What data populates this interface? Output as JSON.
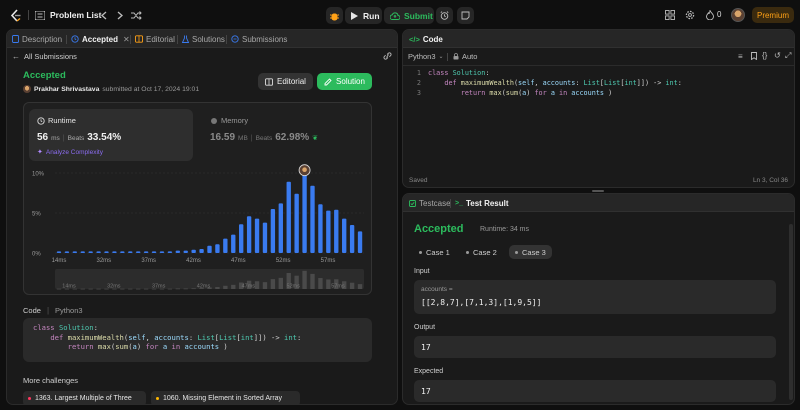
{
  "topbar": {
    "problem_list": "Problem List",
    "run": "Run",
    "submit": "Submit",
    "fire_count": "0",
    "premium": "Premium"
  },
  "left": {
    "tabs": [
      "Description",
      "Accepted",
      "Editorial",
      "Solutions",
      "Submissions"
    ],
    "back_label": "All Submissions",
    "status": "Accepted",
    "user": "Prakhar Shrivastava",
    "submitted": "submitted at Oct 17, 2024 19:01",
    "editorial_btn": "Editorial",
    "solution_btn": "Solution",
    "runtime": {
      "label": "Runtime",
      "value": "56",
      "unit": "ms",
      "beats_label": "Beats",
      "beats": "33.54%",
      "analyze": "Analyze Complexity"
    },
    "memory": {
      "label": "Memory",
      "value": "16.59",
      "unit": "MB",
      "beats_label": "Beats",
      "beats": "62.98%"
    },
    "code_label": "Code",
    "code_lang": "Python3",
    "code_lines": [
      "class Solution:",
      "    def maximumWealth(self, accounts: List[List[int]]) -> int:",
      "        return max(sum(a) for a in accounts )"
    ],
    "more_label": "More challenges",
    "challenges": [
      "1363. Largest Multiple of Three",
      "1060. Missing Element in Sorted Array"
    ],
    "challenge_colors": [
      "#ff375f",
      "#ffb800"
    ]
  },
  "chart_data": {
    "type": "bar",
    "y_ticks": [
      "10%",
      "5%",
      "0%"
    ],
    "ylim": [
      0,
      10
    ],
    "x_tick_labels": [
      "14ms",
      "32ms",
      "37ms",
      "42ms",
      "47ms",
      "52ms",
      "57ms"
    ],
    "values": [
      0.2,
      0.2,
      0.2,
      0.2,
      0.2,
      0.2,
      0.2,
      0.2,
      0.2,
      0.2,
      0.2,
      0.2,
      0.2,
      0.2,
      0.2,
      0.3,
      0.3,
      0.4,
      0.5,
      0.9,
      1.1,
      1.8,
      2.3,
      3.6,
      4.6,
      4.3,
      3.8,
      5.5,
      6.2,
      8.9,
      7.4,
      10.1,
      8.4,
      6.1,
      5.3,
      5.4,
      4.3,
      3.5,
      2.7
    ],
    "highlight_index": 31,
    "bar_color": "#3a7bf0",
    "mini_x_labels": [
      "14ms",
      "32ms",
      "37ms",
      "42ms",
      "47ms",
      "52ms",
      "57ms"
    ]
  },
  "code_panel": {
    "title": "Code",
    "lang": "Python3",
    "auto": "Auto",
    "lines": [
      "class Solution:",
      "    def maximumWealth(self, accounts: List[List[int]]) -> int:",
      "        return max(sum(a) for a in accounts )"
    ],
    "saved": "Saved",
    "cursor": "Ln 3, Col 36"
  },
  "result_panel": {
    "tab_testcase": "Testcase",
    "tab_result": "Test Result",
    "status": "Accepted",
    "runtime": "Runtime: 34 ms",
    "cases": [
      "Case 1",
      "Case 2",
      "Case 3"
    ],
    "input_label": "Input",
    "var_name": "accounts =",
    "var_value": "[[2,8,7],[7,1,3],[1,9,5]]",
    "output_label": "Output",
    "output": "17",
    "expected_label": "Expected",
    "expected": "17"
  },
  "colors": {
    "accent_green": "#2cbb5d",
    "accent_orange": "#ffa116",
    "bg": "#0f0f0f",
    "panel": "#1a1a1a"
  }
}
